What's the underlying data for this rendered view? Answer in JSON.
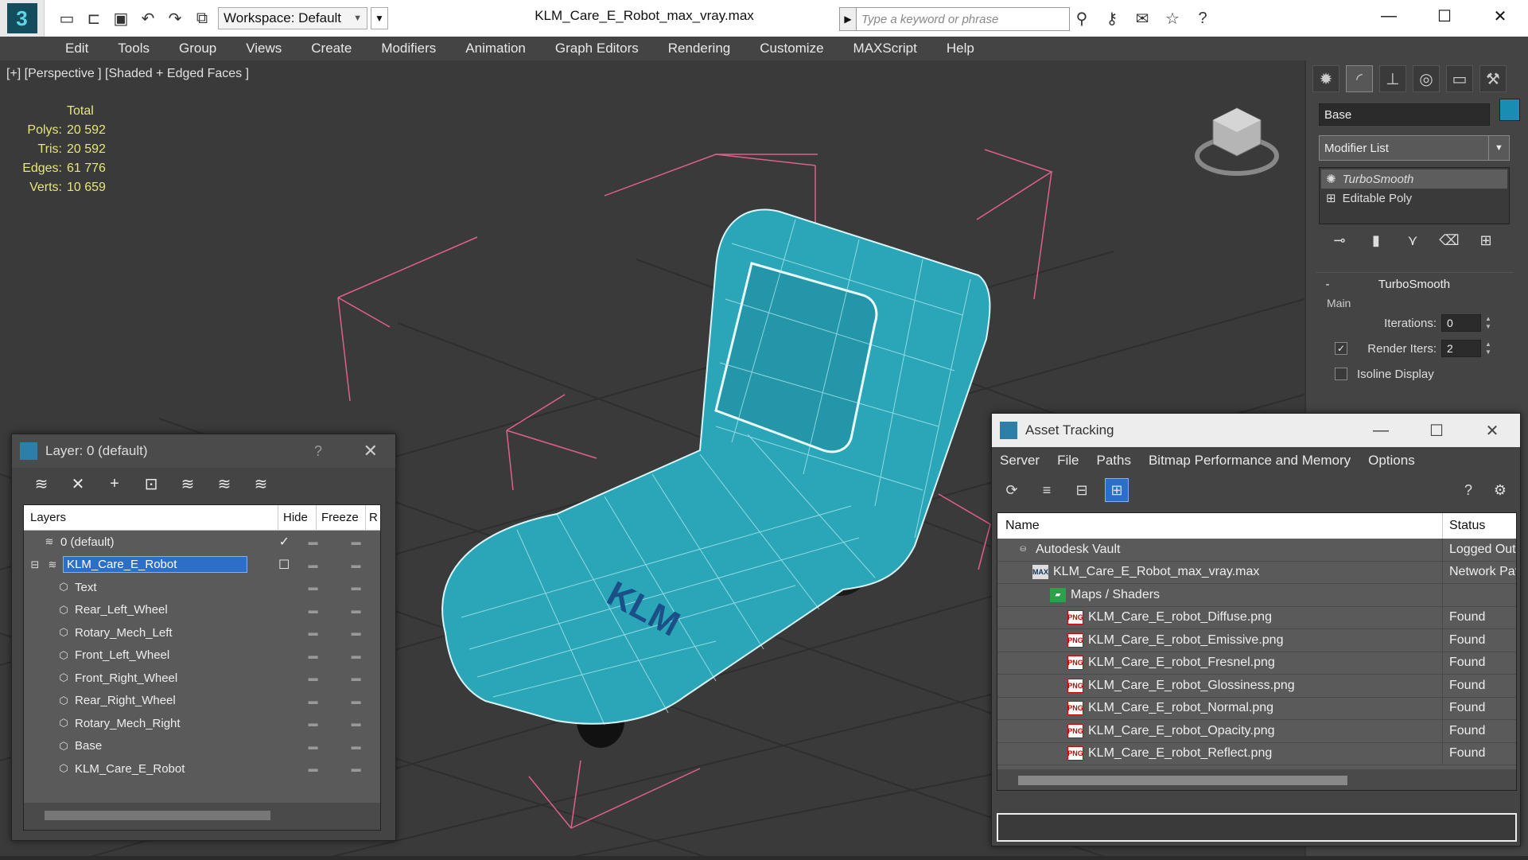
{
  "window": {
    "file_title": "KLM_Care_E_Robot_max_vray.max",
    "workspace": "Workspace: Default",
    "search_placeholder": "Type a keyword or phrase"
  },
  "menu": [
    "Edit",
    "Tools",
    "Group",
    "Views",
    "Create",
    "Modifiers",
    "Animation",
    "Graph Editors",
    "Rendering",
    "Customize",
    "MAXScript",
    "Help"
  ],
  "viewport": {
    "label": "[+] [Perspective ] [Shaded + Edged Faces ]",
    "stats": {
      "total_label": "Total",
      "rows": [
        {
          "key": "Polys:",
          "value": "20 592"
        },
        {
          "key": "Tris:",
          "value": "20 592"
        },
        {
          "key": "Edges:",
          "value": "61 776"
        },
        {
          "key": "Verts:",
          "value": "10 659"
        }
      ]
    },
    "model_logo": "KLM"
  },
  "command_panel": {
    "object_name": "Base",
    "modifier_list": "Modifier List",
    "stack": [
      "TurboSmooth",
      "Editable Poly"
    ],
    "rollout_title": "TurboSmooth",
    "group_main": "Main",
    "iterations_label": "Iterations:",
    "iterations_value": "0",
    "render_iters_label": "Render Iters:",
    "render_iters_value": "2",
    "isoline_label": "Isoline Display",
    "colors": {
      "object_color": "#1a8db3"
    }
  },
  "layer_panel": {
    "title": "Layer: 0 (default)",
    "help": "?",
    "columns": {
      "layers": "Layers",
      "hide": "Hide",
      "freeze": "Freeze",
      "more": "R"
    },
    "rows": [
      {
        "name": "0 (default)",
        "indent": 1,
        "type": "layer",
        "mark": "✓"
      },
      {
        "name": "KLM_Care_E_Robot",
        "indent": 0,
        "type": "layer",
        "selected": true,
        "mark": "☐"
      },
      {
        "name": "Text",
        "indent": 2,
        "type": "object"
      },
      {
        "name": "Rear_Left_Wheel",
        "indent": 2,
        "type": "object"
      },
      {
        "name": "Rotary_Mech_Left",
        "indent": 2,
        "type": "object"
      },
      {
        "name": "Front_Left_Wheel",
        "indent": 2,
        "type": "object"
      },
      {
        "name": "Front_Right_Wheel",
        "indent": 2,
        "type": "object"
      },
      {
        "name": "Rear_Right_Wheel",
        "indent": 2,
        "type": "object"
      },
      {
        "name": "Rotary_Mech_Right",
        "indent": 2,
        "type": "object"
      },
      {
        "name": "Base",
        "indent": 2,
        "type": "object"
      },
      {
        "name": "KLM_Care_E_Robot",
        "indent": 2,
        "type": "object"
      }
    ]
  },
  "asset_panel": {
    "title": "Asset Tracking",
    "menu": [
      "Server",
      "File",
      "Paths",
      "Bitmap Performance and Memory",
      "Options"
    ],
    "columns": {
      "name": "Name",
      "status": "Status"
    },
    "rows": [
      {
        "name": "Autodesk Vault",
        "status": "Logged Out",
        "indent": 1,
        "icon": "vault"
      },
      {
        "name": "KLM_Care_E_Robot_max_vray.max",
        "status": "Network Path",
        "indent": 2,
        "icon": "max"
      },
      {
        "name": "Maps / Shaders",
        "status": "",
        "indent": 3,
        "icon": "folder"
      },
      {
        "name": "KLM_Care_E_robot_Diffuse.png",
        "status": "Found",
        "indent": 4,
        "icon": "png"
      },
      {
        "name": "KLM_Care_E_robot_Emissive.png",
        "status": "Found",
        "indent": 4,
        "icon": "png"
      },
      {
        "name": "KLM_Care_E_robot_Fresnel.png",
        "status": "Found",
        "indent": 4,
        "icon": "png"
      },
      {
        "name": "KLM_Care_E_robot_Glossiness.png",
        "status": "Found",
        "indent": 4,
        "icon": "png"
      },
      {
        "name": "KLM_Care_E_robot_Normal.png",
        "status": "Found",
        "indent": 4,
        "icon": "png"
      },
      {
        "name": "KLM_Care_E_robot_Opacity.png",
        "status": "Found",
        "indent": 4,
        "icon": "png"
      },
      {
        "name": "KLM_Care_E_robot_Reflect.png",
        "status": "Found",
        "indent": 4,
        "icon": "png"
      }
    ]
  }
}
